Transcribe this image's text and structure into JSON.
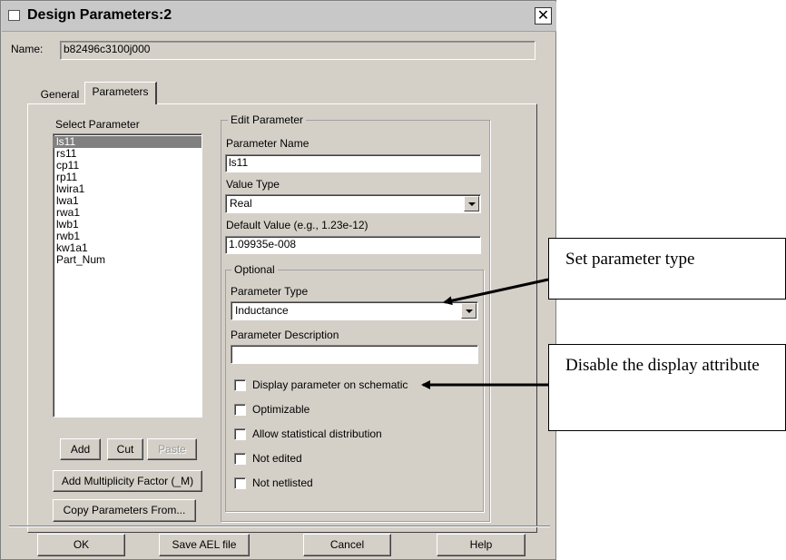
{
  "window": {
    "title": "Design Parameters:2",
    "close_glyph": "✕"
  },
  "name_field": {
    "label": "Name:",
    "value": "b82496c3100j000"
  },
  "tabs": [
    {
      "label": "General"
    },
    {
      "label": "Parameters"
    }
  ],
  "select_parameter": {
    "label": "Select Parameter",
    "items": [
      "ls11",
      "rs11",
      "cp11",
      "rp11",
      "lwira1",
      "lwa1",
      "rwa1",
      "lwb1",
      "rwb1",
      "kw1a1",
      "Part_Num"
    ],
    "selected_index": 0
  },
  "buttons": {
    "add": "Add",
    "cut": "Cut",
    "paste": "Paste",
    "add_multiplicity": "Add Multiplicity Factor (_M)",
    "copy_parameters": "Copy Parameters From...",
    "ok": "OK",
    "save_ael": "Save AEL file",
    "cancel": "Cancel",
    "help": "Help"
  },
  "edit_parameter": {
    "group_label": "Edit Parameter",
    "param_name_label": "Parameter Name",
    "param_name_value": "ls11",
    "value_type_label": "Value Type",
    "value_type_value": "Real",
    "default_value_label": "Default Value (e.g., 1.23e-12)",
    "default_value_value": "1.09935e-008"
  },
  "optional": {
    "group_label": "Optional",
    "param_type_label": "Parameter Type",
    "param_type_value": "Inductance",
    "param_desc_label": "Parameter Description",
    "param_desc_value": "",
    "checkboxes": [
      {
        "label": "Display parameter on schematic",
        "checked": false
      },
      {
        "label": "Optimizable",
        "checked": false
      },
      {
        "label": "Allow statistical distribution",
        "checked": false
      },
      {
        "label": "Not edited",
        "checked": false
      },
      {
        "label": "Not netlisted",
        "checked": false
      }
    ]
  },
  "callouts": {
    "set_type": "Set parameter type",
    "disable_display": "Disable the display attribute"
  },
  "colors": {
    "dialog_bg": "#d4d0c8",
    "selection": "#808080",
    "annotation_arrow": "#000000"
  }
}
